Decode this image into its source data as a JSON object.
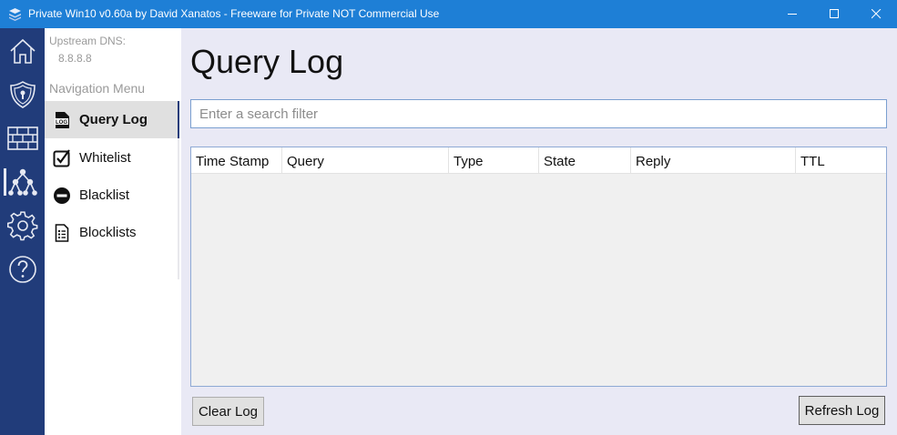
{
  "window": {
    "title": "Private Win10 v0.60a by David Xanatos - Freeware for Private NOT Commercial Use",
    "controls": [
      "minimize",
      "maximize",
      "close"
    ]
  },
  "rail": {
    "items": [
      {
        "icon": "home-icon"
      },
      {
        "icon": "shield-icon"
      },
      {
        "icon": "firewall-icon"
      },
      {
        "icon": "dns-network-icon",
        "active": true
      },
      {
        "icon": "gear-icon"
      },
      {
        "icon": "help-icon"
      }
    ]
  },
  "sidebar": {
    "dns_label": "Upstream DNS:",
    "dns_value": "8.8.8.8",
    "nav_label": "Navigation Menu",
    "items": [
      {
        "label": "Query Log",
        "icon": "log-icon",
        "active": true
      },
      {
        "label": "Whitelist",
        "icon": "checkbox-icon"
      },
      {
        "label": "Blacklist",
        "icon": "block-icon"
      },
      {
        "label": "Blocklists",
        "icon": "list-document-icon"
      }
    ]
  },
  "main": {
    "title": "Query Log",
    "search": {
      "placeholder": "Enter a search filter",
      "value": ""
    },
    "table": {
      "columns": [
        "Time Stamp",
        "Query",
        "Type",
        "State",
        "Reply",
        "TTL"
      ],
      "rows": []
    },
    "clear_button": "Clear Log",
    "refresh_button": "Refresh Log"
  },
  "colors": {
    "titlebar": "#1e7fd6",
    "rail": "#213c7a",
    "content_bg": "#e9e9f5",
    "nav_active_bg": "#e0e0e0"
  }
}
